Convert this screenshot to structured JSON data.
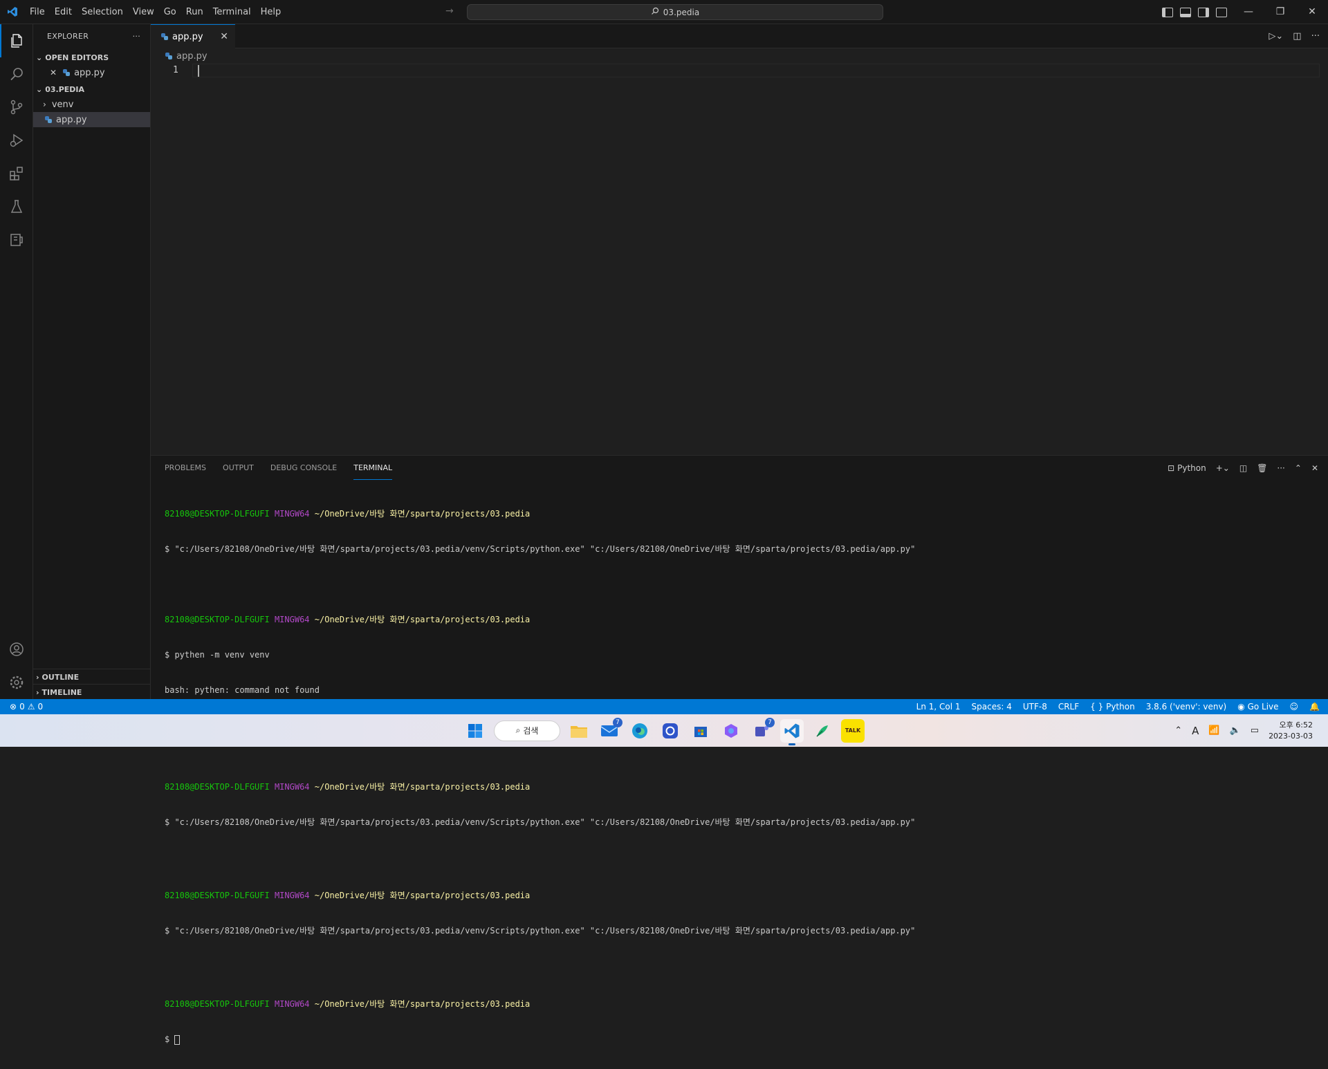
{
  "titlebar": {
    "menu": [
      "File",
      "Edit",
      "Selection",
      "View",
      "Go",
      "Run",
      "Terminal",
      "Help"
    ],
    "search": "03.pedia"
  },
  "sidebar": {
    "title": "EXPLORER",
    "more": "···",
    "open_editors": {
      "title": "OPEN EDITORS",
      "items": [
        "app.py"
      ]
    },
    "folder": {
      "title": "03.PEDIA",
      "items": [
        "venv",
        "app.py"
      ]
    },
    "outline": "OUTLINE",
    "timeline": "TIMELINE"
  },
  "editor": {
    "tab_label": "app.py",
    "breadcrumb": "app.py",
    "line_number": "1"
  },
  "panel": {
    "tabs": [
      "PROBLEMS",
      "OUTPUT",
      "DEBUG CONSOLE",
      "TERMINAL"
    ],
    "terminal_profile": "Python",
    "prompt": {
      "user": "82108@DESKTOP-DLFGUFI",
      "env": "MINGW64",
      "path": "~/OneDrive/바탕 화면/sparta/projects/03.pedia"
    },
    "commands": {
      "run": "$ \"c:/Users/82108/OneDrive/바탕 화면/sparta/projects/03.pedia/venv/Scripts/python.exe\" \"c:/Users/82108/OneDrive/바탕 화면/sparta/projects/03.pedia/app.py\"",
      "venv": "$ pythen -m venv venv",
      "error": "bash: pythen: command not found",
      "final": "$ "
    }
  },
  "statusbar": {
    "errors": "0",
    "warnings": "0",
    "position": "Ln 1, Col 1",
    "spaces": "Spaces: 4",
    "encoding": "UTF-8",
    "eol": "CRLF",
    "language": "Python",
    "interpreter": "3.8.6 ('venv': venv)",
    "golive": "Go Live"
  },
  "taskbar": {
    "search": "검색",
    "mail_badge": "7",
    "teams_badge": "7",
    "kakao_label": "TALK",
    "lang": "A",
    "time": "오후 6:52",
    "date": "2023-03-03"
  },
  "colors": {
    "accent": "#0078d4",
    "prompt_user": "#16c60c",
    "prompt_env": "#b148c6",
    "prompt_path": "#f9f1a5"
  }
}
